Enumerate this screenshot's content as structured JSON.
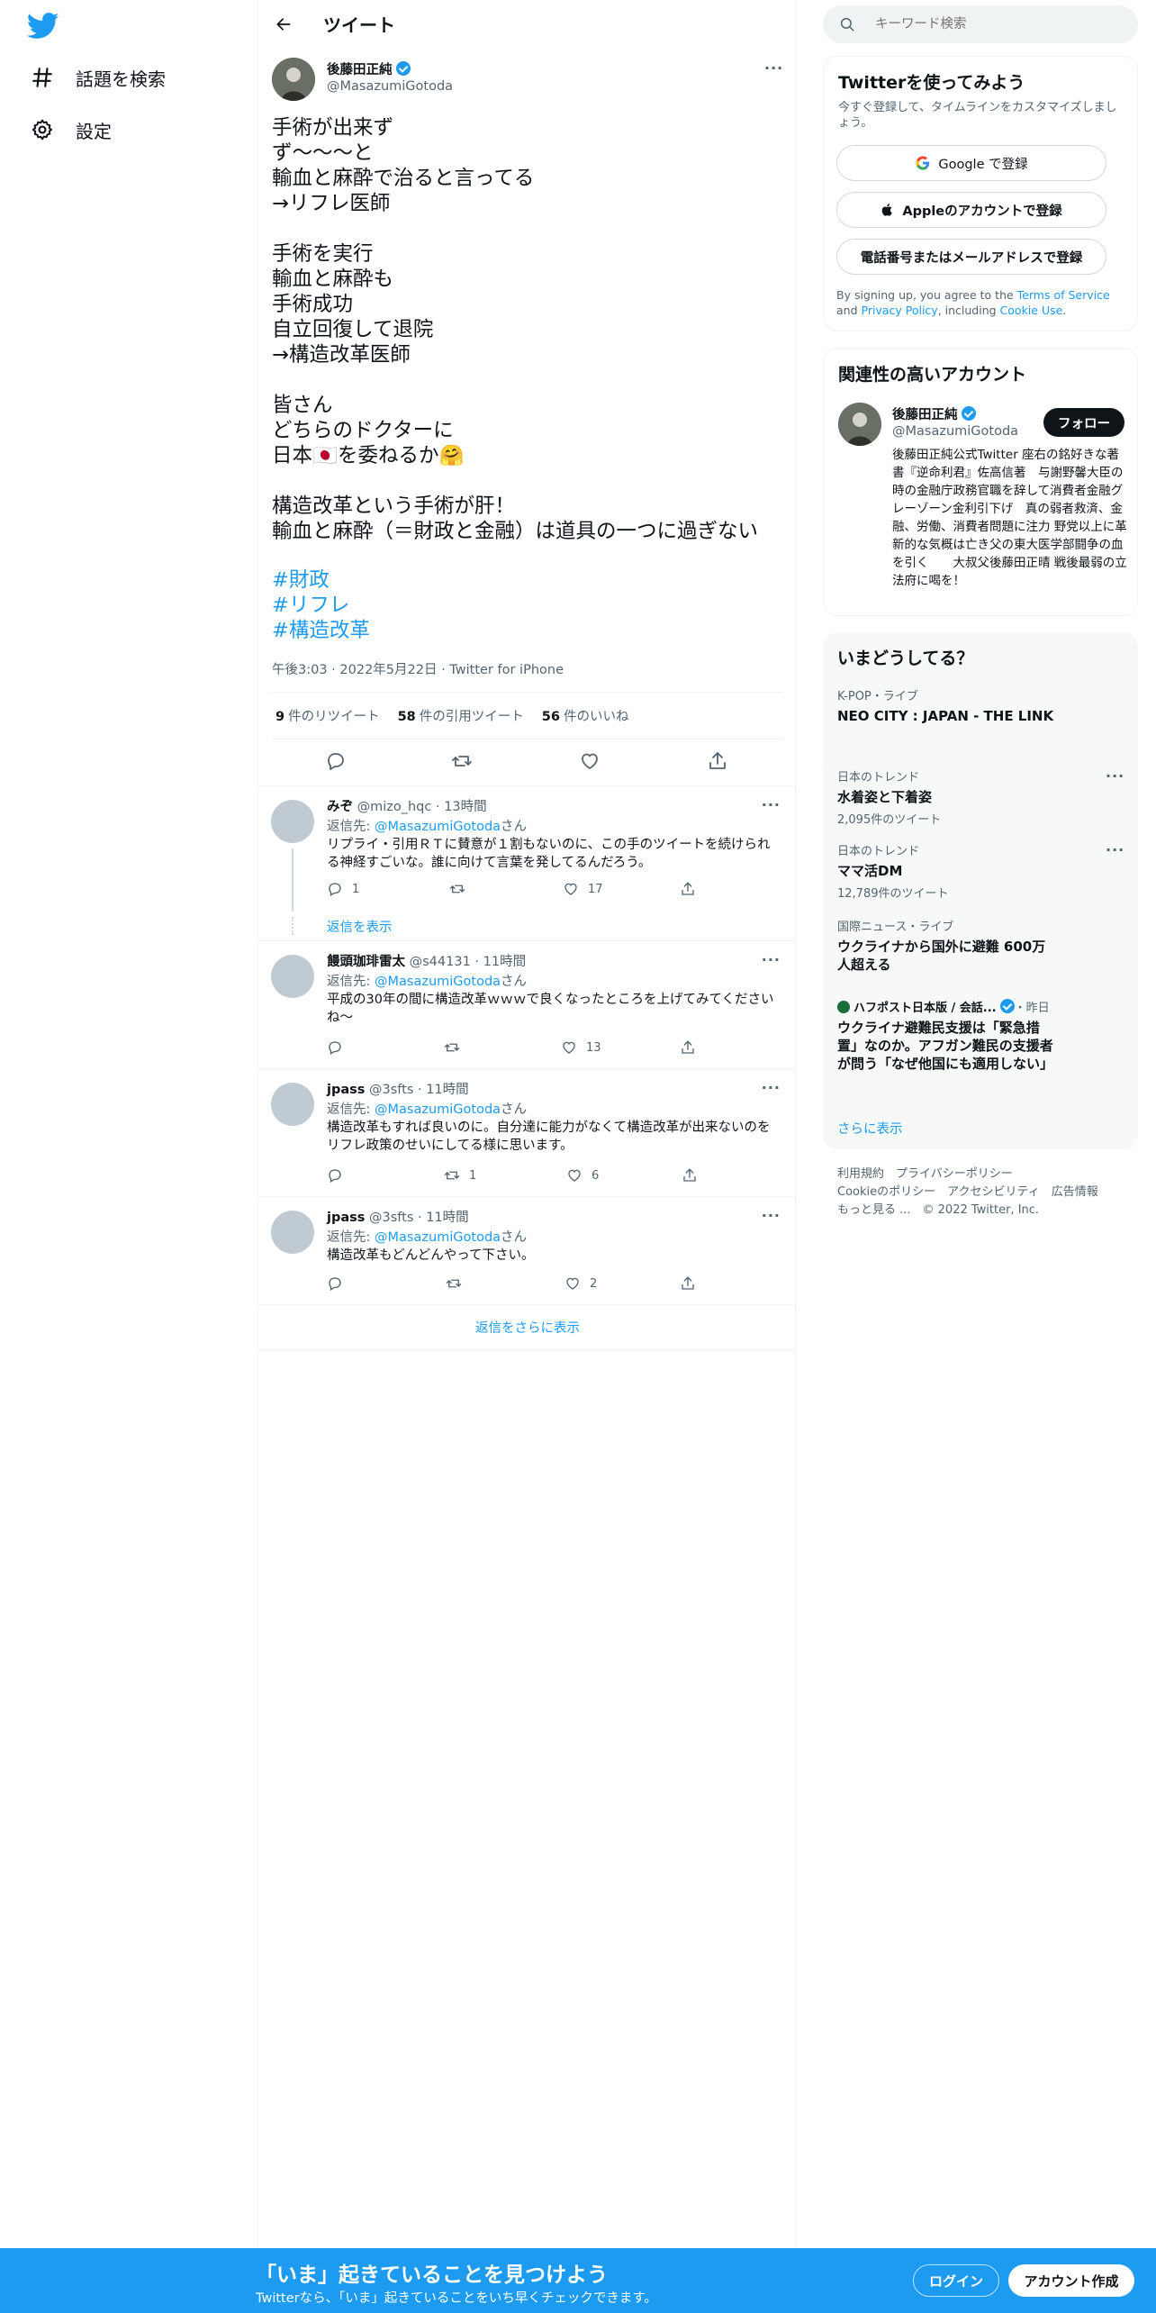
{
  "nav": {
    "explore_label": "話題を検索",
    "settings_label": "設定"
  },
  "header": {
    "title": "ツイート"
  },
  "tweet": {
    "author_name": "後藤田正純",
    "author_handle": "@MasazumiGotoda",
    "body": "手術が出来ず\nず〜〜〜と\n輸血と麻酔で治ると言ってる\n→リフレ医師\n\n手術を実行\n輸血と麻酔も\n手術成功\n自立回復して退院\n→構造改革医師\n\n皆さん\nどちらのドクターに\n日本🇯🇵を委ねるか🤗\n\n構造改革という手術が肝！\n輸血と麻酔（＝財政と金融）は道具の一つに過ぎない",
    "hashtags": [
      "#財政",
      "#リフレ",
      "#構造改革"
    ],
    "time": "午後3:03",
    "date": "2022年5月22日",
    "client": "Twitter for iPhone",
    "retweets": "9",
    "retweets_label": "件のリツイート",
    "quotes": "58",
    "quotes_label": "件の引用ツイート",
    "likes": "56",
    "likes_label": "件のいいね"
  },
  "replies": [
    {
      "name": "みぞ",
      "handle": "@mizo_hqc",
      "time": "13時間",
      "to_prefix": "返信先: ",
      "to_handle": "@MasazumiGotoda",
      "to_suffix": "さん",
      "text": "リプライ・引用ＲＴに賛意が１割もないのに、この手のツイートを続けられる神経すごいな。誰に向けて言葉を発してるんだろう。",
      "replies": "1",
      "retweets": "",
      "likes": "17"
    },
    {
      "name": "饅頭珈琲雷太",
      "handle": "@s44131",
      "time": "11時間",
      "to_prefix": "返信先: ",
      "to_handle": "@MasazumiGotoda",
      "to_suffix": "さん",
      "text": "平成の30年の間に構造改革ｗｗｗで良くなったところを上げてみてくださいね～",
      "replies": "",
      "retweets": "",
      "likes": "13"
    },
    {
      "name": "jpass",
      "handle": "@3sfts",
      "time": "11時間",
      "to_prefix": "返信先: ",
      "to_handle": "@MasazumiGotoda",
      "to_suffix": "さん",
      "text": "構造改革もすれば良いのに。自分達に能力がなくて構造改革が出来ないのをリフレ政策のせいにしてる様に思います。",
      "replies": "",
      "retweets": "1",
      "likes": "6"
    },
    {
      "name": "jpass",
      "handle": "@3sfts",
      "time": "11時間",
      "to_prefix": "返信先: ",
      "to_handle": "@MasazumiGotoda",
      "to_suffix": "さん",
      "text": "構造改革もどんどんやって下さい。",
      "replies": "",
      "retweets": "",
      "likes": "2"
    }
  ],
  "show_replies_label": "返信を表示",
  "more_replies_label": "返信をさらに表示",
  "search": {
    "placeholder": "キーワード検索"
  },
  "signup_panel": {
    "title": "Twitterを使ってみよう",
    "subtitle": "今すぐ登録して、タイムラインをカスタマイズしましょう。",
    "google_label": "Google で登録",
    "apple_label": "Appleのアカウントで登録",
    "phone_label": "電話番号またはメールアドレスで登録",
    "terms_prefix": "By signing up, you agree to the ",
    "terms_link": "Terms of Service",
    "terms_and": " and ",
    "privacy_link": "Privacy Policy",
    "terms_including": ", including ",
    "cookie_link": "Cookie Use",
    "terms_end": "."
  },
  "related": {
    "title": "関連性の高いアカウント",
    "name": "後藤田正純",
    "handle": "@MasazumiGotoda",
    "follow_label": "フォロー",
    "bio": "後藤田正純公式Twitter 座右の銘好きな著書『逆命利君』佐高信著　与謝野馨大臣の時の金融庁政務官職を辞して消費者金融グレーゾーン金利引下げ　真の弱者救済、金融、労働、消費者問題に注力 野党以上に革新的な気概は亡き父の東大医学部闘争の血を引く　　大叔父後藤田正晴 戦後最弱の立法府に喝を！"
  },
  "trends": {
    "title": "いまどうしてる？",
    "items": [
      {
        "context": "K-POP・ライブ",
        "title": "NEO CITY : JAPAN - THE LINK",
        "count": ""
      },
      {
        "context": "日本のトレンド",
        "title": "水着姿と下着姿",
        "count": "2,095件のツイート"
      },
      {
        "context": "日本のトレンド",
        "title": "ママ活DM",
        "count": "12,789件のツイート"
      },
      {
        "context": "国際ニュース・ライブ",
        "title": "ウクライナから国外に避難 600万人超える",
        "count": ""
      },
      {
        "context_source": "ハフポスト日本版 / 会話...",
        "context_time": "・昨日",
        "title": "ウクライナ避難民支援は「緊急措置」なのか。アフガン難民の支援者が問う「なぜ他国にも適用しない」",
        "count": ""
      }
    ],
    "show_more": "さらに表示"
  },
  "footer": {
    "line1": "利用規約　プライバシーポリシー",
    "line2": "Cookieのポリシー　アクセシビリティ　広告情報",
    "line3": "もっと見る ...　© 2022 Twitter, Inc."
  },
  "bottom_bar": {
    "title": "「いま」起きていることを見つけよう",
    "subtitle": "Twitterなら、「いま」起きていることをいち早くチェックできます。",
    "login_label": "ログイン",
    "signup_label": "アカウント作成"
  },
  "colors": {
    "accent": "#1d9bf0",
    "text": "#0f1419",
    "muted": "#536471"
  }
}
